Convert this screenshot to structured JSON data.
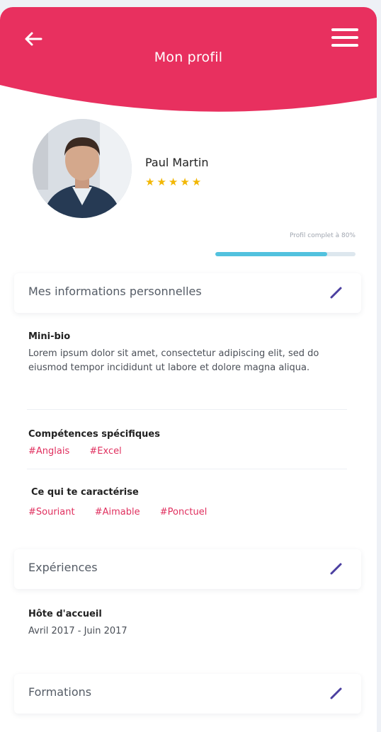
{
  "header": {
    "title": "Mon profil",
    "color": "#e8305f"
  },
  "profile": {
    "name": "Paul Martin",
    "stars": "★★★★★",
    "progress_label": "Profil complet à 80%",
    "progress_value": 0.8
  },
  "sections": {
    "personal": {
      "title": "Mes informations personnelles",
      "bio_label": "Mini-bio",
      "bio_text": "Lorem ipsum dolor sit amet, consectetur adipiscing elit, sed do eiusmod tempor incididunt ut labore et dolore magna aliqua.",
      "skills_label": "Compétences spécifiques",
      "skills": [
        "#Anglais",
        "#Excel"
      ],
      "traits_label": "Ce qui te caractérise",
      "traits": [
        "#Souriant",
        "#Aimable",
        "#Ponctuel"
      ]
    },
    "experiences": {
      "title": "Expériences",
      "job_title": "Hôte d'accueil",
      "job_dates": "Avril 2017 - Juin 2017"
    },
    "formations": {
      "title": "Formations"
    }
  },
  "colors": {
    "accent": "#e8305f",
    "progress": "#52c2de",
    "edit_icon": "#4b3fa0",
    "stars": "#f2b705"
  },
  "icons": {
    "back": "arrow-left-icon",
    "menu": "hamburger-menu-icon",
    "edit": "pencil-icon"
  }
}
